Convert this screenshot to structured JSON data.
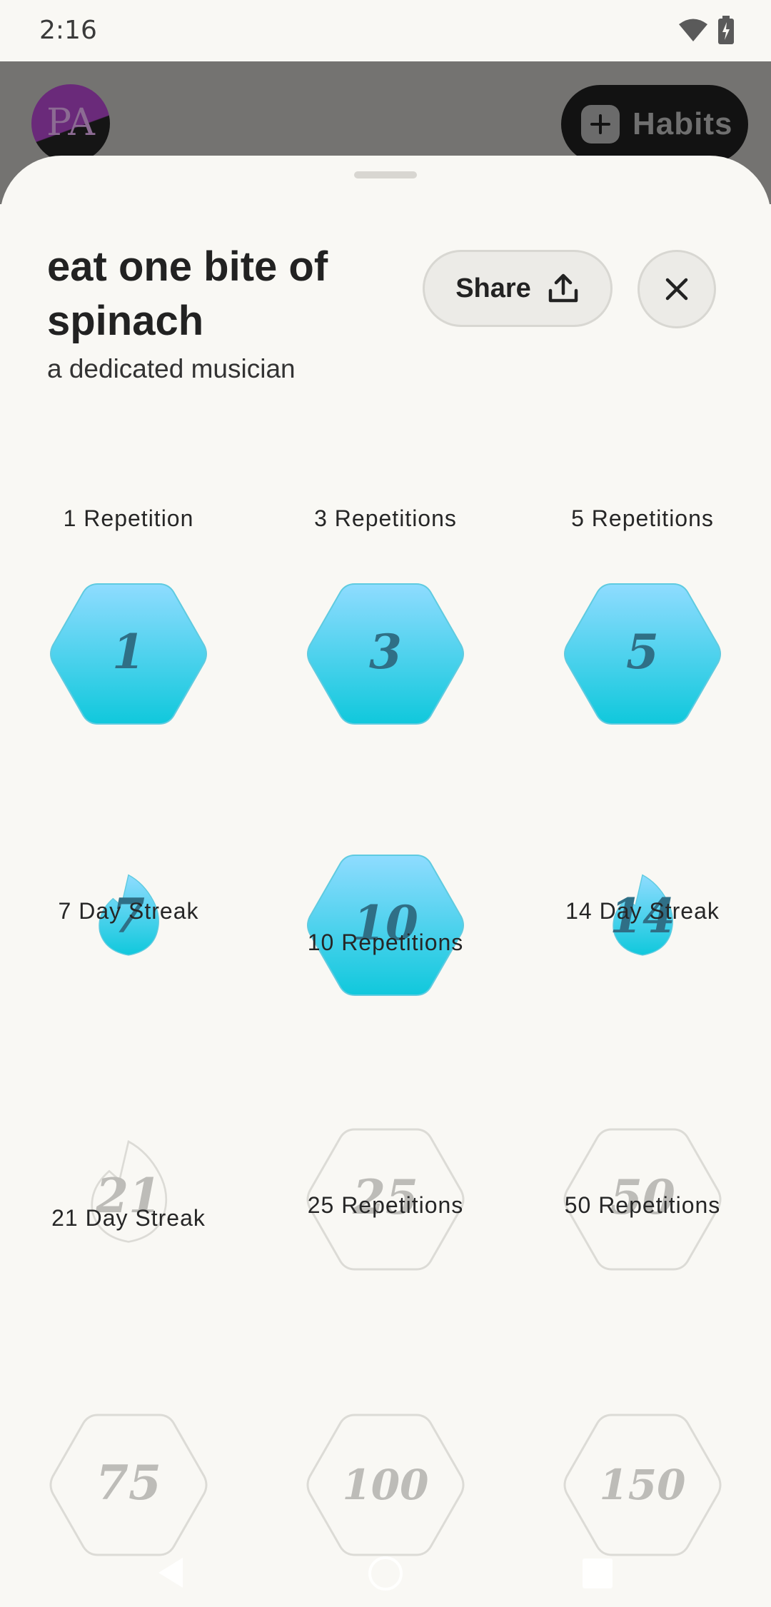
{
  "status_bar": {
    "time": "2:16"
  },
  "background_app": {
    "avatar_initials": "PA",
    "habits_button_label": "Habits"
  },
  "sheet": {
    "title": "eat one bite of spinach",
    "subtitle": "a dedicated musician",
    "share_label": "Share"
  },
  "badges": [
    {
      "number": "1",
      "label": "1 Repetition",
      "shape": "hexagon",
      "earned": true
    },
    {
      "number": "3",
      "label": "3 Repetitions",
      "shape": "hexagon",
      "earned": true
    },
    {
      "number": "5",
      "label": "5 Repetitions",
      "shape": "hexagon",
      "earned": true
    },
    {
      "number": "7",
      "label": "7 Day Streak",
      "shape": "flame",
      "earned": true
    },
    {
      "number": "10",
      "label": "10 Repetitions",
      "shape": "hexagon",
      "earned": true
    },
    {
      "number": "14",
      "label": "14 Day Streak",
      "shape": "flame",
      "earned": true
    },
    {
      "number": "21",
      "label": "21 Day Streak",
      "shape": "flame",
      "earned": false
    },
    {
      "number": "25",
      "label": "25 Repetitions",
      "shape": "hexagon",
      "earned": false
    },
    {
      "number": "50",
      "label": "50 Repetitions",
      "shape": "hexagon",
      "earned": false
    },
    {
      "number": "75",
      "label": "",
      "shape": "hexagon",
      "earned": false
    },
    {
      "number": "100",
      "label": "",
      "shape": "hexagon",
      "earned": false
    },
    {
      "number": "150",
      "label": "",
      "shape": "hexagon",
      "earned": false
    }
  ],
  "colors": {
    "earned_top": "#8fdcff",
    "earned_bottom": "#10c8dc",
    "earned_text": "#2f6f86",
    "locked_stroke": "#dcdbd6",
    "locked_text": "#bdbcb8"
  }
}
